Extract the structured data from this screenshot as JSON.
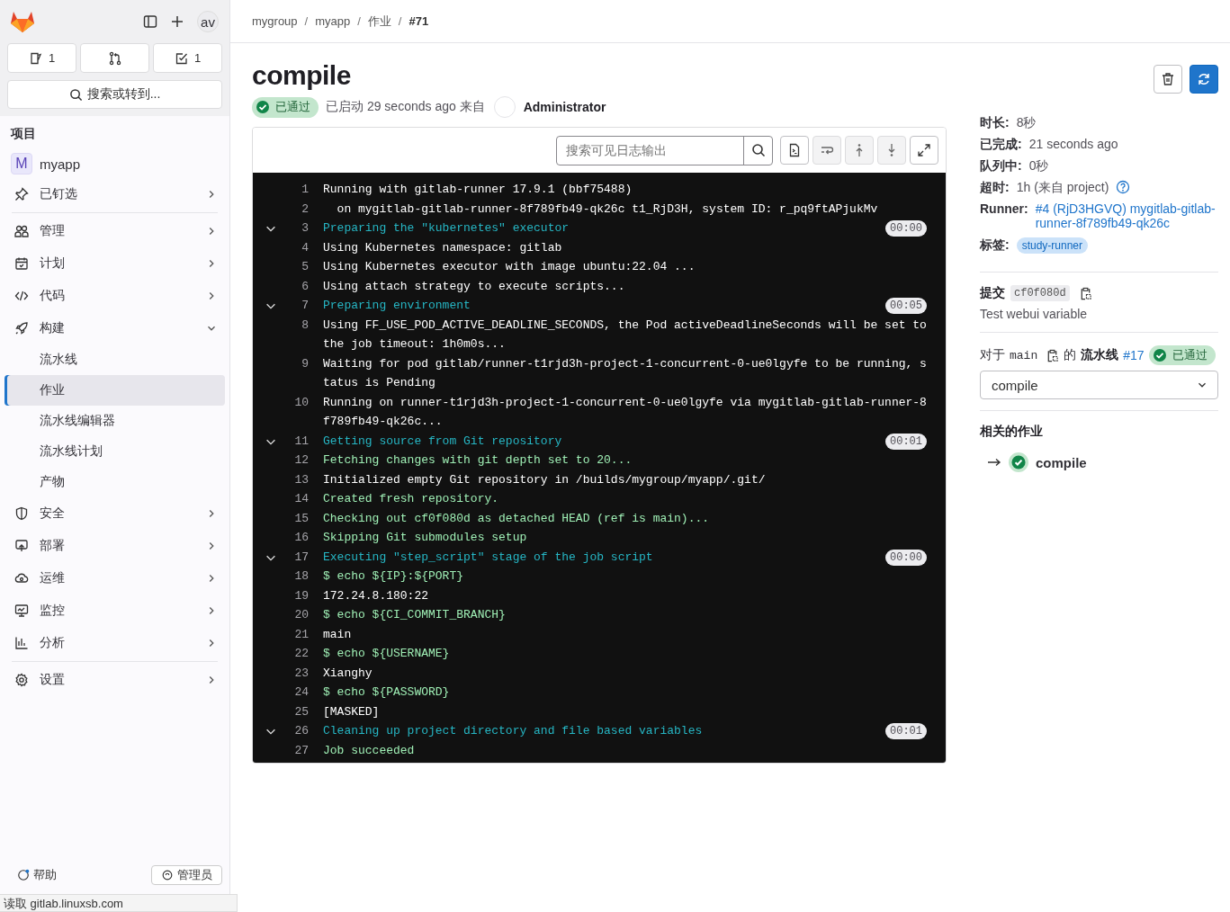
{
  "sidebar": {
    "quick_buttons": [
      {
        "kind": "issues",
        "count": "1"
      },
      {
        "kind": "merge-requests"
      },
      {
        "kind": "todos",
        "count": "1"
      }
    ],
    "avatar": "av",
    "search_label": "搜索或转到...",
    "section_title": "项目",
    "project": {
      "initial": "M",
      "name": "myapp"
    },
    "nav": [
      {
        "label": "已钉选",
        "expanded": false,
        "divider_after": true
      },
      {
        "label": "管理",
        "expanded": false
      },
      {
        "label": "计划",
        "expanded": false
      },
      {
        "label": "代码",
        "expanded": false
      },
      {
        "label": "构建",
        "expanded": true,
        "children": [
          {
            "label": "流水线",
            "selected": false
          },
          {
            "label": "作业",
            "selected": true
          },
          {
            "label": "流水线编辑器",
            "selected": false
          },
          {
            "label": "流水线计划",
            "selected": false
          },
          {
            "label": "产物",
            "selected": false
          }
        ]
      },
      {
        "label": "安全",
        "expanded": false
      },
      {
        "label": "部署",
        "expanded": false
      },
      {
        "label": "运维",
        "expanded": false
      },
      {
        "label": "监控",
        "expanded": false
      },
      {
        "label": "分析",
        "expanded": false,
        "divider_after": true
      },
      {
        "label": "设置",
        "expanded": false
      }
    ],
    "footer": [
      {
        "label": "帮助",
        "kind": "help"
      },
      {
        "label": "管理员",
        "kind": "admin"
      }
    ]
  },
  "status_bar": "读取 gitlab.linuxsb.com",
  "breadcrumbs": [
    {
      "label": "mygroup",
      "current": false
    },
    {
      "separator": "/",
      "label": "myapp",
      "current": false
    },
    {
      "separator": "/",
      "label": "作业",
      "current": false
    },
    {
      "separator": "/",
      "label": "#71",
      "current": true
    }
  ],
  "job": {
    "title": "compile",
    "status": "已通过",
    "started": "已启动 29 seconds ago 来自",
    "user": "Administrator"
  },
  "log": {
    "search_placeholder": "搜索可见日志输出",
    "lines": [
      {
        "number": "1",
        "text": "Running with gitlab-runner 17.9.1 (bbf75488)",
        "kind": "output"
      },
      {
        "number": "2",
        "text": "  on mygitlab-gitlab-runner-8f789fb49-qk26c t1_RjD3H, system ID: r_pq9ftAPjukMv",
        "kind": "output"
      },
      {
        "number": "3",
        "text": "Preparing the \"kubernetes\" executor",
        "kind": "section",
        "expanded": true,
        "duration": "00:00"
      },
      {
        "number": "4",
        "text": "Using Kubernetes namespace: gitlab",
        "kind": "output"
      },
      {
        "number": "5",
        "text": "Using Kubernetes executor with image ubuntu:22.04 ...",
        "kind": "output"
      },
      {
        "number": "6",
        "text": "Using attach strategy to execute scripts...",
        "kind": "output"
      },
      {
        "number": "7",
        "text": "Preparing environment",
        "kind": "section",
        "expanded": true,
        "duration": "00:05"
      },
      {
        "number": "8",
        "text": "Using FF_USE_POD_ACTIVE_DEADLINE_SECONDS, the Pod activeDeadlineSeconds will be set to the job timeout: 1h0m0s...",
        "kind": "output"
      },
      {
        "number": "9",
        "text": "Waiting for pod gitlab/runner-t1rjd3h-project-1-concurrent-0-ue0lgyfe to be running, status is Pending",
        "kind": "output"
      },
      {
        "number": "10",
        "text": "Running on runner-t1rjd3h-project-1-concurrent-0-ue0lgyfe via mygitlab-gitlab-runner-8f789fb49-qk26c...",
        "kind": "output"
      },
      {
        "number": "11",
        "text": "Getting source from Git repository",
        "kind": "section",
        "expanded": true,
        "duration": "00:01"
      },
      {
        "number": "12",
        "text": "Fetching changes with git depth set to 20...",
        "kind": "success"
      },
      {
        "number": "13",
        "text": "Initialized empty Git repository in /builds/mygroup/myapp/.git/",
        "kind": "output"
      },
      {
        "number": "14",
        "text": "Created fresh repository.",
        "kind": "success"
      },
      {
        "number": "15",
        "text": "Checking out cf0f080d as detached HEAD (ref is main)...",
        "kind": "success"
      },
      {
        "number": "16",
        "text": "Skipping Git submodules setup",
        "kind": "success"
      },
      {
        "number": "17",
        "text": "Executing \"step_script\" stage of the job script",
        "kind": "section",
        "expanded": true,
        "duration": "00:00"
      },
      {
        "number": "18",
        "text": "$ echo ${IP}:${PORT}",
        "kind": "success"
      },
      {
        "number": "19",
        "text": "172.24.8.180:22",
        "kind": "output"
      },
      {
        "number": "20",
        "text": "$ echo ${CI_COMMIT_BRANCH}",
        "kind": "success"
      },
      {
        "number": "21",
        "text": "main",
        "kind": "output"
      },
      {
        "number": "22",
        "text": "$ echo ${USERNAME}",
        "kind": "success"
      },
      {
        "number": "23",
        "text": "Xianghy",
        "kind": "output"
      },
      {
        "number": "24",
        "text": "$ echo ${PASSWORD}",
        "kind": "success"
      },
      {
        "number": "25",
        "text": "[MASKED]",
        "kind": "output"
      },
      {
        "number": "26",
        "text": "Cleaning up project directory and file based variables",
        "kind": "section",
        "expanded": true,
        "duration": "00:01"
      },
      {
        "number": "27",
        "text": "Job succeeded",
        "kind": "success"
      }
    ]
  },
  "details": [
    {
      "label": "时长:",
      "value": "8秒",
      "kind": "text"
    },
    {
      "label": "已完成:",
      "value": "21 seconds ago",
      "kind": "text"
    },
    {
      "label": "队列中:",
      "value": "0秒",
      "kind": "text"
    },
    {
      "label": "超时:",
      "value": "1h (来自 project)",
      "kind": "help"
    },
    {
      "label": "Runner:",
      "value": "#4 (RjD3HGVQ) mygitlab-gitlab-runner-8f789fb49-qk26c",
      "kind": "link"
    },
    {
      "label": "标签:",
      "value": "study-runner",
      "kind": "tag"
    }
  ],
  "commit": {
    "label": "提交",
    "sha": "cf0f080d",
    "message": "Test webui variable"
  },
  "pipeline": {
    "prefix": "对于",
    "branch": "main",
    "middle": "的",
    "label": "流水线",
    "number": "#17",
    "status": "已通过"
  },
  "stage_select": {
    "value": "compile"
  },
  "related": {
    "title": "相关的作业",
    "jobs": [
      {
        "name": "compile",
        "current": true
      }
    ]
  }
}
